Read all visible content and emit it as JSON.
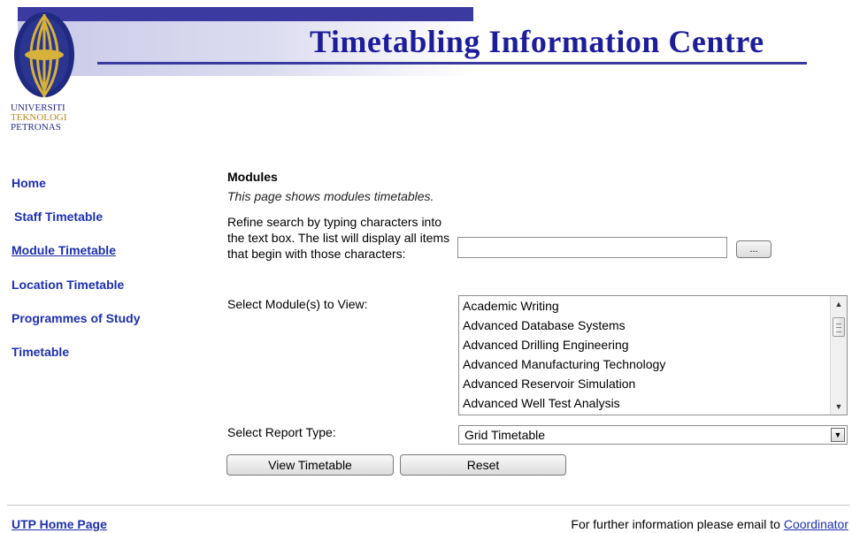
{
  "header": {
    "title": "Timetabling Information Centre",
    "logo_lines": [
      "UNIVERSITI",
      "TEKNOLOGI",
      "PETRONAS"
    ]
  },
  "sidebar": {
    "items": [
      {
        "label": "Home"
      },
      {
        "label": "Staff Timetable"
      },
      {
        "label": "Module Timetable"
      },
      {
        "label": "Location Timetable"
      },
      {
        "label": "Programmes of Study"
      },
      {
        "label": "Timetable"
      }
    ]
  },
  "main": {
    "title": "Modules",
    "description": "This page shows modules timetables.",
    "refine_text": "Refine search by typing characters into the text box. The list will display all items that begin with those characters:",
    "search_value": "",
    "ellipsis_label": "...",
    "select_label": "Select Module(s) to View:",
    "modules": [
      "Academic Writing",
      "Advanced Database Systems",
      "Advanced Drilling Engineering",
      "Advanced Manufacturing Technology",
      "Advanced Reservoir Simulation",
      "Advanced Well Test Analysis"
    ],
    "report_label": "Select Report Type:",
    "report_value": "Grid Timetable",
    "view_button": "View Timetable",
    "reset_button": "Reset"
  },
  "footer": {
    "home_link": "UTP Home Page",
    "info_text": "For further information please email to",
    "coordinator_link": "Coordinator"
  },
  "colors": {
    "brand_blue": "#1d1d9a",
    "link_blue": "#1d2fb0",
    "banner_bar": "#3a3aa0"
  }
}
